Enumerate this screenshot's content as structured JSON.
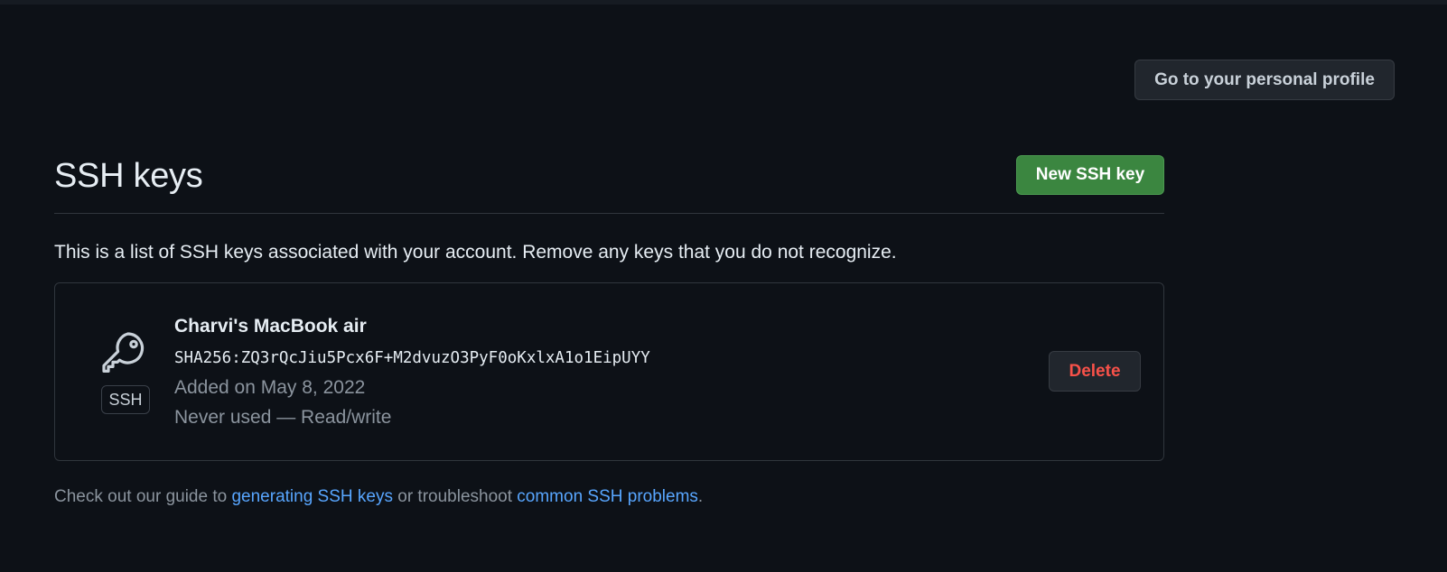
{
  "header": {
    "profile_button_label": "Go to your personal profile"
  },
  "ssh_section": {
    "title": "SSH keys",
    "new_key_button_label": "New SSH key",
    "description": "This is a list of SSH keys associated with your account. Remove any keys that you do not recognize.",
    "keys": [
      {
        "title": "Charvi's MacBook air",
        "fingerprint": "SHA256:ZQ3rQcJiu5Pcx6F+M2dvuzO3PyF0oKxlxA1o1EipUYY",
        "added": "Added on May 8, 2022",
        "usage": "Never used — Read/write",
        "badge": "SSH",
        "icon": "key-icon",
        "delete_label": "Delete"
      }
    ]
  },
  "footer": {
    "prefix": "Check out our guide to ",
    "link1": "generating SSH keys",
    "middle": " or troubleshoot ",
    "link2": "common SSH problems",
    "suffix": "."
  },
  "colors": {
    "background": "#0d1117",
    "primary_button": "#3b8640",
    "danger_text": "#f85149",
    "link": "#58a6ff",
    "muted_text": "#8b949e"
  }
}
